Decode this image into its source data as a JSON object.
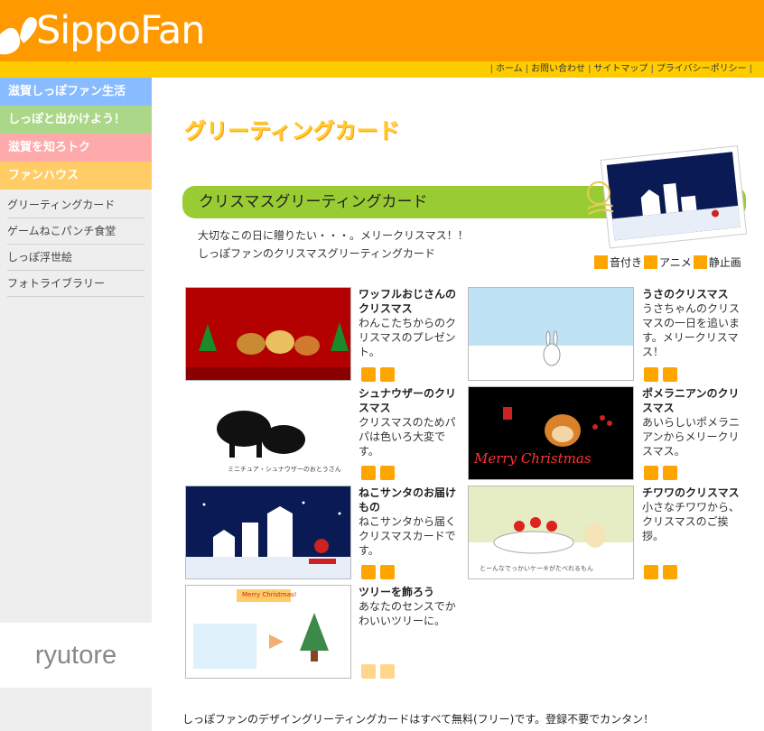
{
  "site": {
    "logo": "SippoFan"
  },
  "topnav": {
    "items": [
      "ホーム",
      "お問い合わせ",
      "サイトマップ",
      "プライバシーポリシー"
    ]
  },
  "sidebar": {
    "categories": [
      "滋賀しっぽファン生活",
      "しっぽと出かけよう！",
      "滋賀を知ろトク",
      "ファンハウス"
    ],
    "links": [
      "グリーティングカード",
      "ゲームねこパンチ食堂",
      "しっぽ浮世絵",
      "フォトライブラリー"
    ],
    "footer": "ryutore"
  },
  "main": {
    "page_title": "グリーティングカード",
    "section_title": "クリスマスグリーティングカード",
    "intro_line1": "大切なこの日に贈りたい・・・。メリークリスマス！！",
    "intro_line2": "しっぽファンのクリスマスグリーティングカード",
    "legend": {
      "sound": "音付き",
      "anime": "アニメ",
      "still": "静止画"
    },
    "footer_note": "しっぽファンのデザイングリーティングカードはすべて無料(フリー)です。登録不要でカンタン！"
  },
  "cards": [
    {
      "title": "ワッフルおじさんのクリスマス",
      "desc": "わんこたちからのクリスマスのプレゼント。"
    },
    {
      "title": "うさのクリスマス",
      "desc": "うさちゃんのクリスマスの一日を追います。メリークリスマス！"
    },
    {
      "title": "シュナウザーのクリスマス",
      "desc": "クリスマスのためパパは色いろ大変です。",
      "thumb_caption": "ミニチュア・シュナウザーのおとうさん"
    },
    {
      "title": "ポメラニアンのクリスマス",
      "desc": "あいらしいポメラニアンからメリークリスマス。",
      "thumb_text": "Merry Christmas"
    },
    {
      "title": "ねこサンタのお届けもの",
      "desc": "ねこサンタから届くクリスマスカードです。"
    },
    {
      "title": "チワワのクリスマス",
      "desc": "小さなチワワから、クリスマスのご挨拶。",
      "thumb_caption": "とーんなでっかいケーキがたべれるもん"
    },
    {
      "title": "ツリーを飾ろう",
      "desc": "あなたのセンスでかわいいツリーに。",
      "thumb_text": "Merry Christmas!"
    }
  ],
  "colors": {
    "header": "#ff9900",
    "nav": "#ffcc00",
    "section_bar": "#99cc33",
    "icon": "#ffa500"
  },
  "icons": [
    "sound-icon",
    "anime-icon",
    "still-icon"
  ]
}
